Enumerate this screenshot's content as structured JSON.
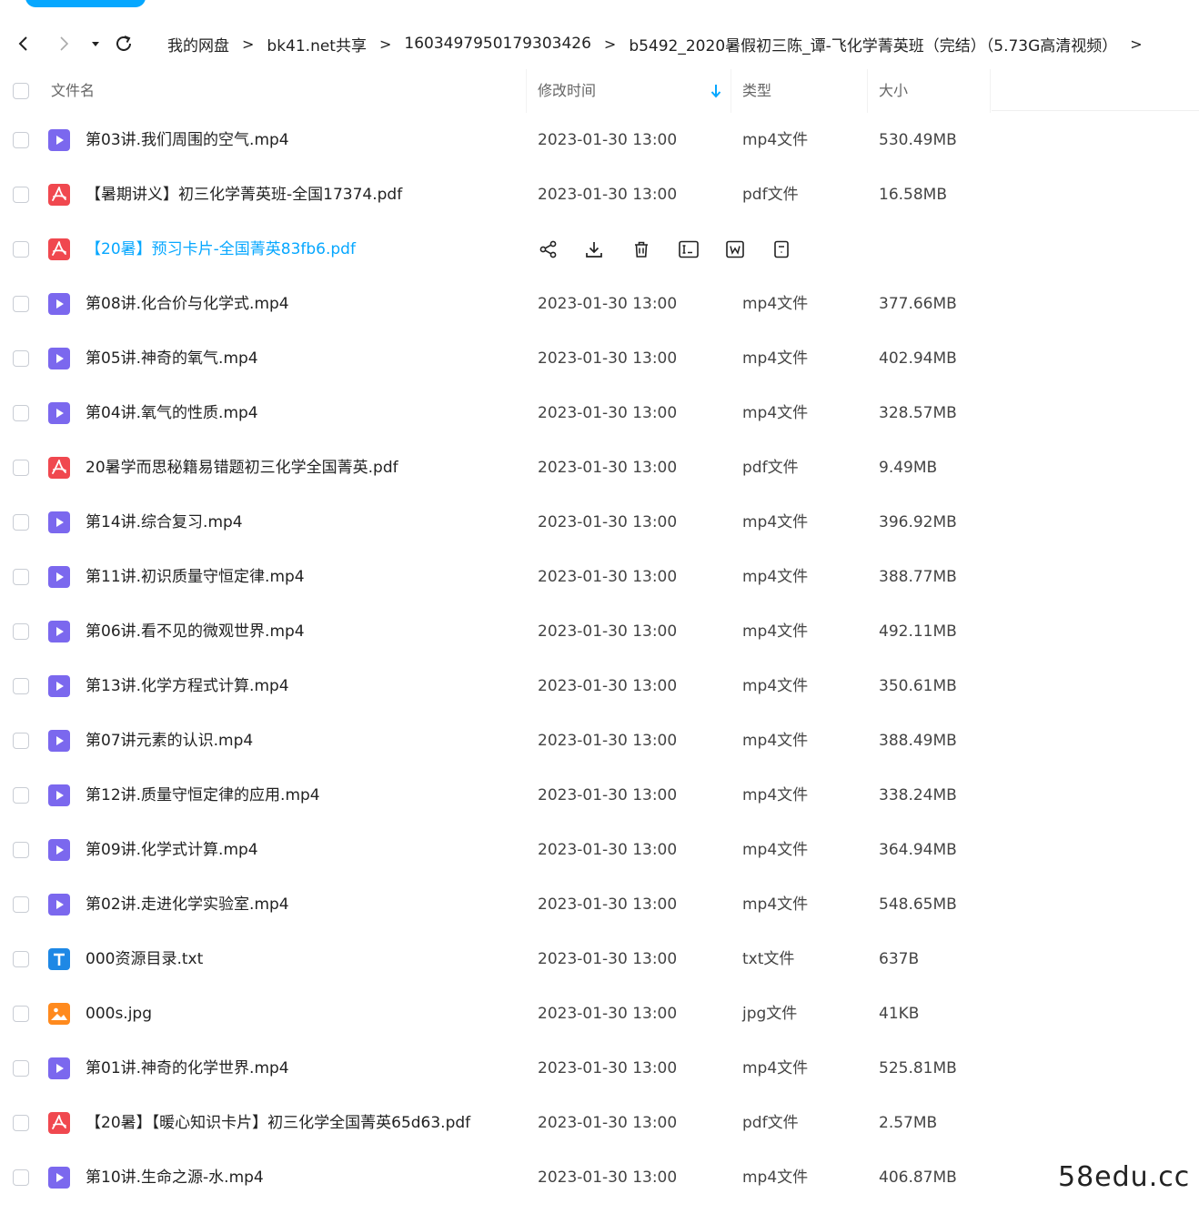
{
  "colors": {
    "accent": "#06a7ff",
    "mp4": "#7b68ee",
    "pdf": "#f0484f",
    "txt": "#1e88e5",
    "jpg": "#ff8a1e"
  },
  "nav": {
    "back_icon": "chevron-left-icon",
    "forward_icon": "chevron-right-icon",
    "dropdown_icon": "caret-down-icon",
    "refresh_icon": "refresh-icon",
    "breadcrumb": [
      "我的网盘",
      "bk41.net共享",
      "1603497950179303426",
      "b5492_2020暑假初三陈_谭-飞化学菁英班（完结）（5.73G高清视频）"
    ],
    "separator": ">"
  },
  "header": {
    "name": "文件名",
    "modified": "修改时间",
    "type": "类型",
    "size": "大小",
    "sort_icon": "arrow-down-icon"
  },
  "row_actions": [
    "share-icon",
    "download-icon",
    "delete-icon",
    "rename-icon",
    "word-icon",
    "more-icon"
  ],
  "files": [
    {
      "name": "第03讲.我们周围的空气.mp4",
      "date": "2023-01-30 13:00",
      "type": "mp4文件",
      "size": "530.49MB",
      "kind": "mp4"
    },
    {
      "name": "【暑期讲义】初三化学菁英班-全国17374.pdf",
      "date": "2023-01-30 13:00",
      "type": "pdf文件",
      "size": "16.58MB",
      "kind": "pdf"
    },
    {
      "name": "【20暑】预习卡片-全国菁英83fb6.pdf",
      "date": "",
      "type": "",
      "size": "",
      "kind": "pdf",
      "hovered": true
    },
    {
      "name": "第08讲.化合价与化学式.mp4",
      "date": "2023-01-30 13:00",
      "type": "mp4文件",
      "size": "377.66MB",
      "kind": "mp4"
    },
    {
      "name": "第05讲.神奇的氧气.mp4",
      "date": "2023-01-30 13:00",
      "type": "mp4文件",
      "size": "402.94MB",
      "kind": "mp4"
    },
    {
      "name": "第04讲.氧气的性质.mp4",
      "date": "2023-01-30 13:00",
      "type": "mp4文件",
      "size": "328.57MB",
      "kind": "mp4"
    },
    {
      "name": "20暑学而思秘籍易错题初三化学全国菁英.pdf",
      "date": "2023-01-30 13:00",
      "type": "pdf文件",
      "size": "9.49MB",
      "kind": "pdf"
    },
    {
      "name": "第14讲.综合复习.mp4",
      "date": "2023-01-30 13:00",
      "type": "mp4文件",
      "size": "396.92MB",
      "kind": "mp4"
    },
    {
      "name": "第11讲.初识质量守恒定律.mp4",
      "date": "2023-01-30 13:00",
      "type": "mp4文件",
      "size": "388.77MB",
      "kind": "mp4"
    },
    {
      "name": "第06讲.看不见的微观世界.mp4",
      "date": "2023-01-30 13:00",
      "type": "mp4文件",
      "size": "492.11MB",
      "kind": "mp4"
    },
    {
      "name": "第13讲.化学方程式计算.mp4",
      "date": "2023-01-30 13:00",
      "type": "mp4文件",
      "size": "350.61MB",
      "kind": "mp4"
    },
    {
      "name": "第07讲元素的认识.mp4",
      "date": "2023-01-30 13:00",
      "type": "mp4文件",
      "size": "388.49MB",
      "kind": "mp4"
    },
    {
      "name": "第12讲.质量守恒定律的应用.mp4",
      "date": "2023-01-30 13:00",
      "type": "mp4文件",
      "size": "338.24MB",
      "kind": "mp4"
    },
    {
      "name": "第09讲.化学式计算.mp4",
      "date": "2023-01-30 13:00",
      "type": "mp4文件",
      "size": "364.94MB",
      "kind": "mp4"
    },
    {
      "name": "第02讲.走进化学实验室.mp4",
      "date": "2023-01-30 13:00",
      "type": "mp4文件",
      "size": "548.65MB",
      "kind": "mp4"
    },
    {
      "name": "000资源目录.txt",
      "date": "2023-01-30 13:00",
      "type": "txt文件",
      "size": "637B",
      "kind": "txt"
    },
    {
      "name": "000s.jpg",
      "date": "2023-01-30 13:00",
      "type": "jpg文件",
      "size": "41KB",
      "kind": "jpg"
    },
    {
      "name": "第01讲.神奇的化学世界.mp4",
      "date": "2023-01-30 13:00",
      "type": "mp4文件",
      "size": "525.81MB",
      "kind": "mp4"
    },
    {
      "name": "【20暑】【暖心知识卡片】初三化学全国菁英65d63.pdf",
      "date": "2023-01-30 13:00",
      "type": "pdf文件",
      "size": "2.57MB",
      "kind": "pdf"
    },
    {
      "name": "第10讲.生命之源-水.mp4",
      "date": "2023-01-30 13:00",
      "type": "mp4文件",
      "size": "406.87MB",
      "kind": "mp4"
    }
  ],
  "watermark": "58edu.cc"
}
